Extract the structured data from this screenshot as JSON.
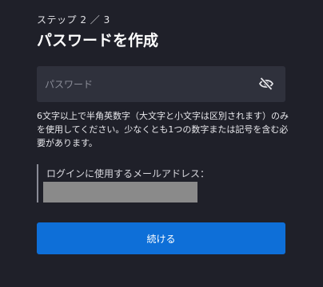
{
  "header": {
    "step": "ステップ 2 ／ 3",
    "title": "パスワードを作成"
  },
  "password": {
    "placeholder": "パスワード",
    "value": "",
    "toggle_icon": "eye-slash-icon"
  },
  "hint": "6文字以上で半角英数字（大文字と小文字は区別されます）のみを使用してください。少なくとも1つの数字または記号を含む必要があります。",
  "email": {
    "label": "ログインに使用するメールアドレス："
  },
  "actions": {
    "continue_label": "続ける"
  },
  "colors": {
    "background": "#1f2029",
    "field": "#2f313c",
    "primary": "#0e6fd8"
  }
}
